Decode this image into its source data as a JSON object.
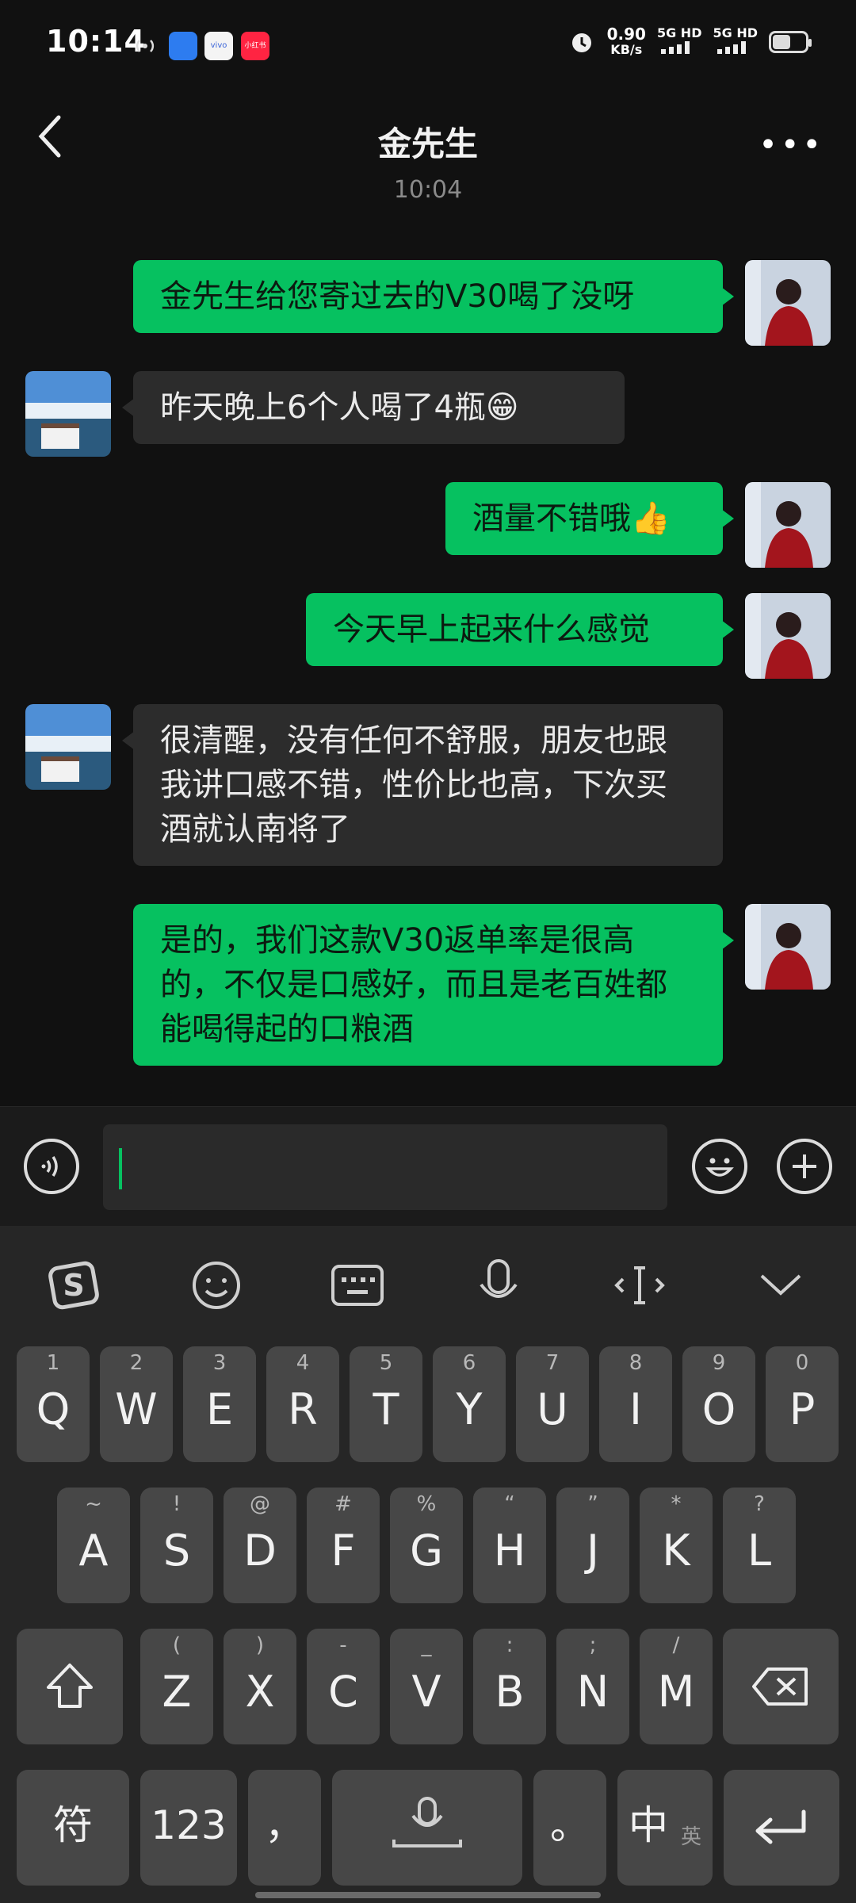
{
  "status_bar": {
    "time": "10:14",
    "speed_value": "0.90",
    "speed_unit": "KB/s",
    "signal1": "5G HD",
    "signal2": "5G HD",
    "app_badge_red": "小红书",
    "app_badge_vivo": "vivo",
    "battery_level": 0.55
  },
  "header": {
    "title": "金先生"
  },
  "timestamp": "10:04",
  "messages": [
    {
      "side": "mine",
      "text": "金先生给您寄过去的V30喝了没呀"
    },
    {
      "side": "theirs",
      "text": "昨天晚上6个人喝了4瓶😁"
    },
    {
      "side": "mine",
      "text": "酒量不错哦👍"
    },
    {
      "side": "mine",
      "text": "今天早上起来什么感觉"
    },
    {
      "side": "theirs",
      "text": "很清醒，没有任何不舒服，朋友也跟我讲口感不错，性价比也高，下次买酒就认南将了"
    },
    {
      "side": "mine",
      "text": "是的，我们这款V30返单率是很高的，不仅是口感好，而且是老百姓都能喝得起的口粮酒"
    }
  ],
  "input": {
    "value": ""
  },
  "keyboard": {
    "row1": [
      {
        "hint": "1",
        "key": "Q"
      },
      {
        "hint": "2",
        "key": "W"
      },
      {
        "hint": "3",
        "key": "E"
      },
      {
        "hint": "4",
        "key": "R"
      },
      {
        "hint": "5",
        "key": "T"
      },
      {
        "hint": "6",
        "key": "Y"
      },
      {
        "hint": "7",
        "key": "U"
      },
      {
        "hint": "8",
        "key": "I"
      },
      {
        "hint": "9",
        "key": "O"
      },
      {
        "hint": "0",
        "key": "P"
      }
    ],
    "row2": [
      {
        "hint": "~",
        "key": "A"
      },
      {
        "hint": "!",
        "key": "S"
      },
      {
        "hint": "@",
        "key": "D"
      },
      {
        "hint": "#",
        "key": "F"
      },
      {
        "hint": "%",
        "key": "G"
      },
      {
        "hint": "“",
        "key": "H"
      },
      {
        "hint": "”",
        "key": "J"
      },
      {
        "hint": "*",
        "key": "K"
      },
      {
        "hint": "?",
        "key": "L"
      }
    ],
    "row3": [
      {
        "hint": "(",
        "key": "Z"
      },
      {
        "hint": ")",
        "key": "X"
      },
      {
        "hint": "-",
        "key": "C"
      },
      {
        "hint": "_",
        "key": "V"
      },
      {
        "hint": ":",
        "key": "B"
      },
      {
        "hint": ";",
        "key": "N"
      },
      {
        "hint": "/",
        "key": "M"
      }
    ],
    "symbol_key": "符",
    "number_key": "123",
    "comma_key": "，",
    "period_key": "。",
    "lang_key_main": "中",
    "lang_key_sub": "英",
    "toolbar_icons": [
      "sogou-logo-icon",
      "emoji-face-icon",
      "keyboard-icon",
      "microphone-icon",
      "cursor-move-icon",
      "collapse-chevron-icon"
    ]
  }
}
